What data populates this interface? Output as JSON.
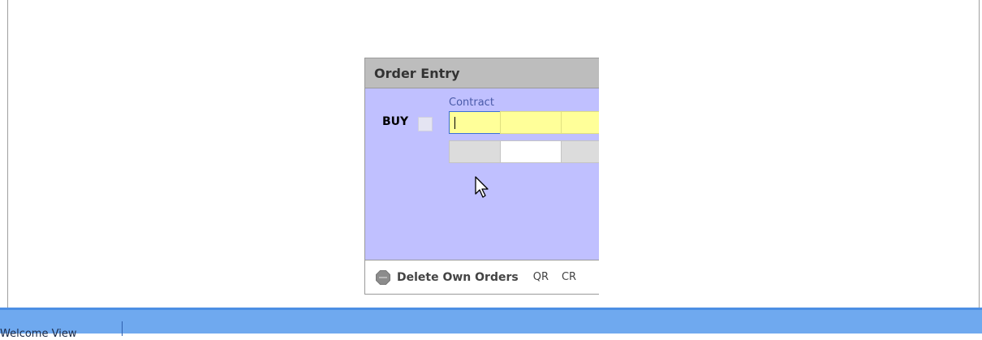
{
  "order_entry": {
    "title": "Order Entry",
    "contract_label": "Contract",
    "side_label": "BUY",
    "contract_input_value": "",
    "footer": {
      "delete_label": "Delete Own Orders",
      "qr_label": "QR",
      "cr_label": "CR"
    }
  },
  "status_bar": {
    "tab_label": "Welcome View"
  },
  "colors": {
    "panel_bg": "#c0c0ff",
    "title_bg": "#bdbdbd",
    "input_yellow": "#ffff99",
    "status_bar": "#6fa9ef"
  },
  "icons": {
    "delete": "stop-sign-icon",
    "cursor": "mouse-pointer-icon"
  }
}
